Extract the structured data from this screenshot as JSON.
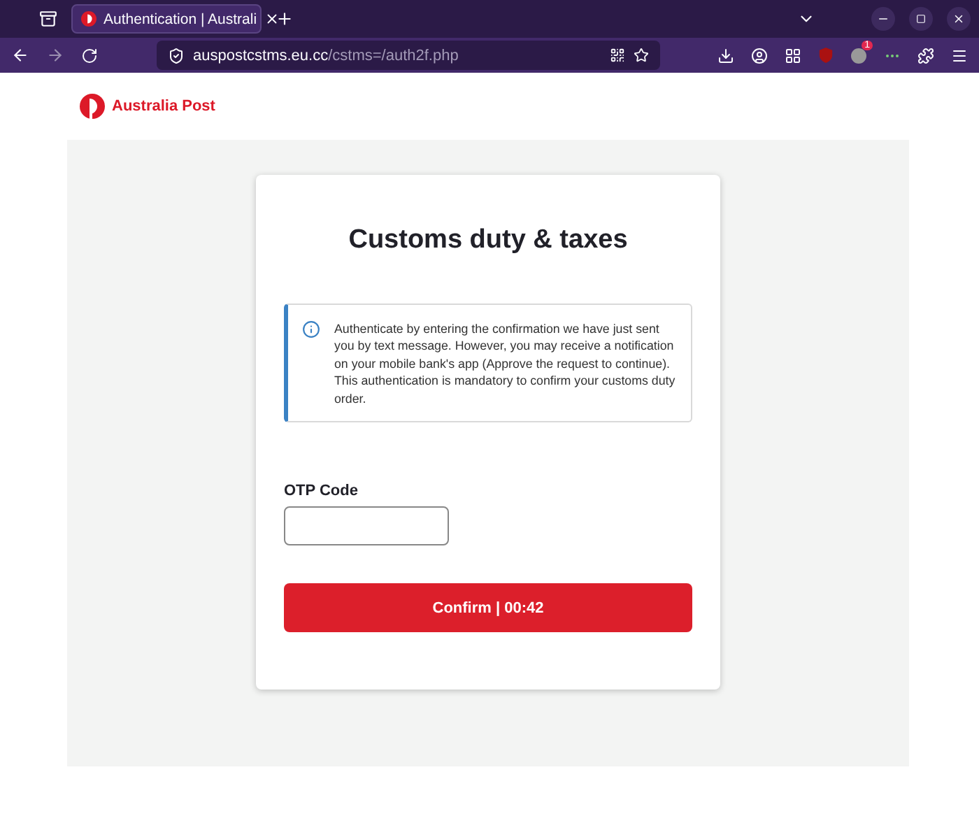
{
  "browser": {
    "tabs": [
      {
        "title": "Authentication | Australi",
        "selected": true
      }
    ],
    "address": {
      "host": "auspostcstms.eu.cc",
      "path": "/cstms=/auth2f.php"
    },
    "extension_badge": "1"
  },
  "page": {
    "logo": "Australia Post",
    "title": "Customs duty & taxes",
    "notice": "Authenticate by entering the confirmation we have just sent you by text message. However, you may receive a notification on your mobile bank's app (Approve the request to continue). This authentication is mandatory to confirm your customs duty order.",
    "field_label": "OTP Code",
    "button": "Confirm | 00:42"
  }
}
